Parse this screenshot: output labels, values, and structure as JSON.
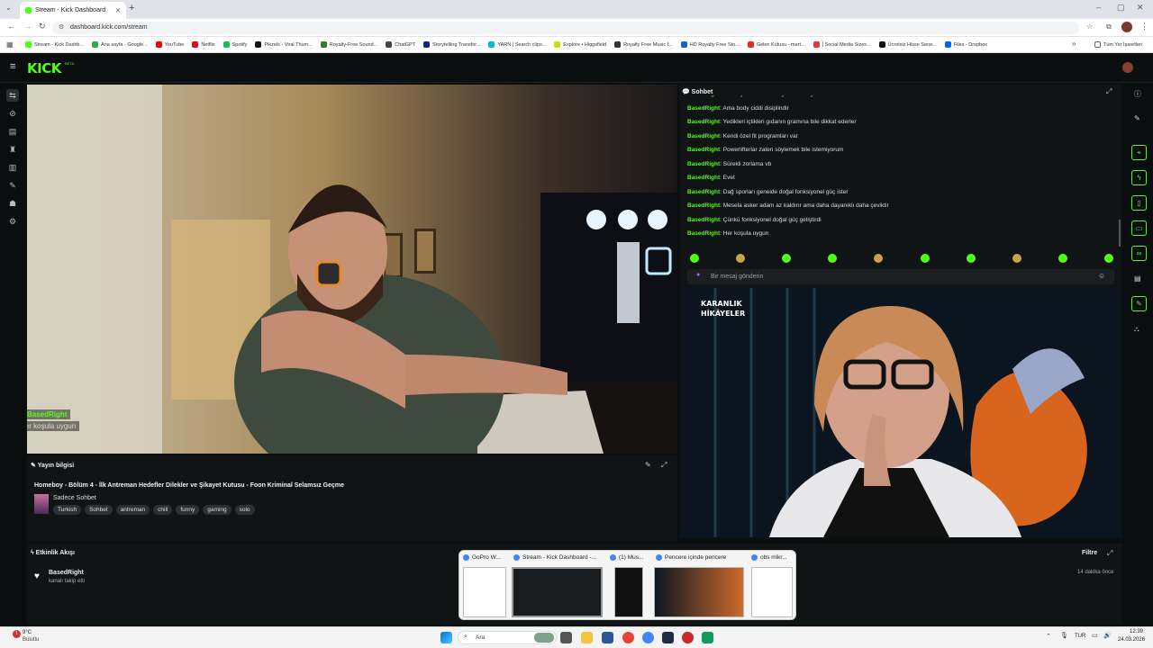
{
  "browser": {
    "tabs": [
      {
        "title": "Stream - Kick Dashboard"
      }
    ],
    "url": "dashboard.kick.com/stream",
    "bookmarks": [
      {
        "label": "Stream - Kick Dashb...",
        "color": "#53fc18"
      },
      {
        "label": "Ana sayfa - Google...",
        "color": "#34a853"
      },
      {
        "label": "YouTube",
        "color": "#ff0000"
      },
      {
        "label": "Netflix",
        "color": "#e50914"
      },
      {
        "label": "Spotify",
        "color": "#1db954"
      },
      {
        "label": "Pikzels - Viral Thum...",
        "color": "#111111"
      },
      {
        "label": "Royalty-Free Sound...",
        "color": "#2e7d32"
      },
      {
        "label": "ChatGPT",
        "color": "#444444"
      },
      {
        "label": "Storytelling Transfor...",
        "color": "#1a237e"
      },
      {
        "label": "YARN | Search clips...",
        "color": "#00bcd4"
      },
      {
        "label": "Explore • Higgsfield",
        "color": "#c6e000"
      },
      {
        "label": "Royalty Free Music f...",
        "color": "#333333"
      },
      {
        "label": "HD Royalty Free Sto...",
        "color": "#1565c0"
      },
      {
        "label": "Gelen Kutusu - mert...",
        "color": "#d93025"
      },
      {
        "label": "| Social Media Sizes...",
        "color": "#e53935"
      },
      {
        "label": "Ücretsiz Hisse Sene...",
        "color": "#111111"
      },
      {
        "label": "Files - Dropbox",
        "color": "#0061ff"
      }
    ],
    "other_bookmarks": "Tüm Yer İşaretleri"
  },
  "kick": {
    "logo": "KICK",
    "beta": "BETA"
  },
  "video_overlay": {
    "username": "BasedRight",
    "message": "Her koşula uygun"
  },
  "stream_info": {
    "header": "Yayın bilgisi",
    "title": "Homeboy - Bölüm 4 - İlk Antreman Hedefler Dilekler ve Şikayet Kutusu - Foon Kriminal Selamsız Geçme",
    "category": "Sadece Sohbet",
    "tags": [
      "Turkish",
      "Sohbet",
      "antreman",
      "chill",
      "funny",
      "gaming",
      "solo"
    ]
  },
  "chat": {
    "header": "Sohbet",
    "messages": [
      {
        "user": "BasedRight",
        "text": "Fonksiyonel kuvvet istiyorsan body olmaz"
      },
      {
        "user": "BasedRight",
        "text": "Ama body ciddi disiplindir"
      },
      {
        "user": "BasedRight",
        "text": "Yedikleri içtikleri gıdanın gramına bile dikkat ederler"
      },
      {
        "user": "BasedRight",
        "text": "Kendi özel fit programları var"
      },
      {
        "user": "BasedRight",
        "text": "Powerlifterlar zaten söylemek bile istemiyorum"
      },
      {
        "user": "BasedRight",
        "text": "Sürekli zorlama vb"
      },
      {
        "user": "BasedRight",
        "text": "Evet"
      },
      {
        "user": "BasedRight",
        "text": "Dağ sporları geneide doğal fonksiyonel güç ister"
      },
      {
        "user": "BasedRight",
        "text": "Mesela asker adam az kaldırır ama daha dayanıklı daha çeviktir"
      },
      {
        "user": "BasedRight",
        "text": "Çünkü fonksiyonel doğal güç geliştirdi"
      },
      {
        "user": "BasedRight",
        "text": "Her koşula uygun"
      }
    ],
    "input_placeholder": "Bir mesaj gönderin"
  },
  "pip_overlay": {
    "line1": "KARANLIK",
    "line2": "HİKÂYELER"
  },
  "activity": {
    "header": "Etkinlik Akışı",
    "filter": "Filtre",
    "events": [
      {
        "user": "BasedRight",
        "detail": "kanalı takip etti",
        "time": "14 dakika önce"
      }
    ]
  },
  "switcher": {
    "windows": [
      {
        "title": "GoPro W..."
      },
      {
        "title": "Stream - Kick Dashboard -..."
      },
      {
        "title": "(1) Mus..."
      },
      {
        "title": "Pencere içinde pencere"
      },
      {
        "title": "obs mikr..."
      }
    ]
  },
  "taskbar": {
    "weather_temp": "9°C",
    "weather_desc": "Bulutlu",
    "search": "Ara",
    "lang": "TUR",
    "time": "12:39",
    "date": "24.03.2026",
    "notification_count": "1"
  }
}
